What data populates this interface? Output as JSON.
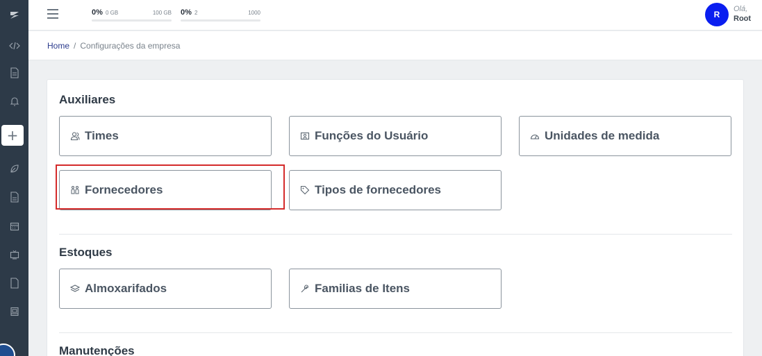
{
  "sidebar": {
    "logo_icon": "zeus-logo-icon",
    "items": [
      {
        "icon": "code-icon"
      },
      {
        "icon": "document-icon"
      },
      {
        "icon": "bell-icon"
      },
      {
        "icon": "plus-icon",
        "label": "+"
      },
      {
        "icon": "leaf-icon"
      },
      {
        "icon": "file-icon"
      },
      {
        "icon": "calendar-icon"
      },
      {
        "icon": "tv-icon"
      },
      {
        "icon": "page-icon"
      },
      {
        "icon": "book-icon"
      }
    ]
  },
  "topbar": {
    "storage": {
      "percent": "0%",
      "min": "0 GB",
      "max": "100 GB",
      "fill": 0
    },
    "users": {
      "percent": "0%",
      "min": "2",
      "max": "1000",
      "fill": 0
    },
    "avatar_initial": "R",
    "greeting": "Olá,",
    "username": "Root"
  },
  "breadcrumb": {
    "home": "Home",
    "separator": "/",
    "current": "Configurações da empresa"
  },
  "sections": [
    {
      "title": "Auxiliares",
      "items": [
        {
          "label": "Times",
          "icon": "users-icon"
        },
        {
          "label": "Funções do Usuário",
          "icon": "id-card-icon"
        },
        {
          "label": "Unidades de medida",
          "icon": "gauge-icon"
        },
        {
          "label": "Fornecedores",
          "icon": "suppliers-icon"
        },
        {
          "label": "Tipos de fornecedores",
          "icon": "tag-icon"
        }
      ]
    },
    {
      "title": "Estoques",
      "items": [
        {
          "label": "Almoxarifados",
          "icon": "layers-icon"
        },
        {
          "label": "Familias de Itens",
          "icon": "tools-icon"
        }
      ]
    },
    {
      "title": "Manutenções",
      "items": []
    }
  ],
  "colors": {
    "sidebar": "#2d3a48",
    "accent": "#0a1ef0",
    "highlight": "#d42a2a"
  }
}
